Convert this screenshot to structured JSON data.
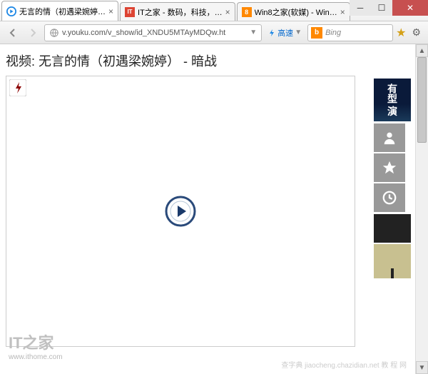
{
  "tabs": [
    {
      "title": "无言的情（初遇梁婉婷…",
      "active": true,
      "icon": "youku"
    },
    {
      "title": "IT之家 - 数码，科技，…",
      "active": false,
      "icon": "ithome"
    },
    {
      "title": "Win8之家(软媒) - Win…",
      "active": false,
      "icon": "win8"
    }
  ],
  "addressbar": {
    "url": "v.youku.com/v_show/id_XNDU5MTAyMDQw.ht",
    "speed_label": "高速",
    "search_placeholder": "Bing"
  },
  "page": {
    "video_title": "视频: 无言的情（初遇梁婉婷） - 暗战",
    "sidebar_thumb1": "有型\n演"
  },
  "watermark": {
    "logo": "IT之家",
    "url": "www.ithome.com",
    "right": "查字典  jiaocheng.chazidian.net  教 程 网"
  }
}
